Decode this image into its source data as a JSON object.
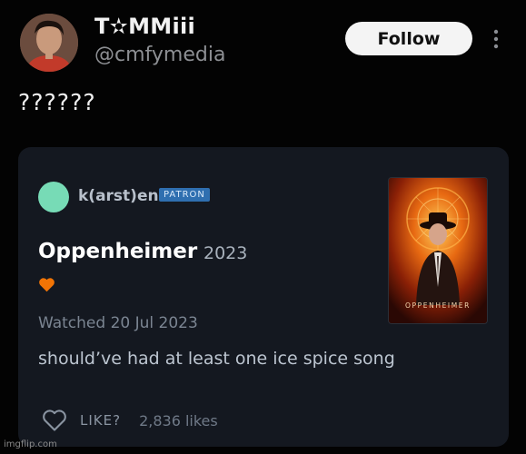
{
  "tweet": {
    "author": {
      "display_name": "T✫MMiii",
      "handle": "@cmfymedia"
    },
    "follow_label": "Follow",
    "text": "??????"
  },
  "quoted_review": {
    "username": "k(arst)en",
    "badge": "PATRON",
    "film_title": "Oppenheimer",
    "film_year": "2023",
    "watched": "Watched 20 Jul 2023",
    "review": "should’ve had at least one ice spice song",
    "like_label": "LIKE?",
    "likes": "2,836 likes",
    "poster_caption": "OPPENHEIMER",
    "avatar_color": "#77dbb6",
    "heart_color": "#f27405",
    "badge_color": "#2f6fb0"
  },
  "watermark": "imgflip.com"
}
